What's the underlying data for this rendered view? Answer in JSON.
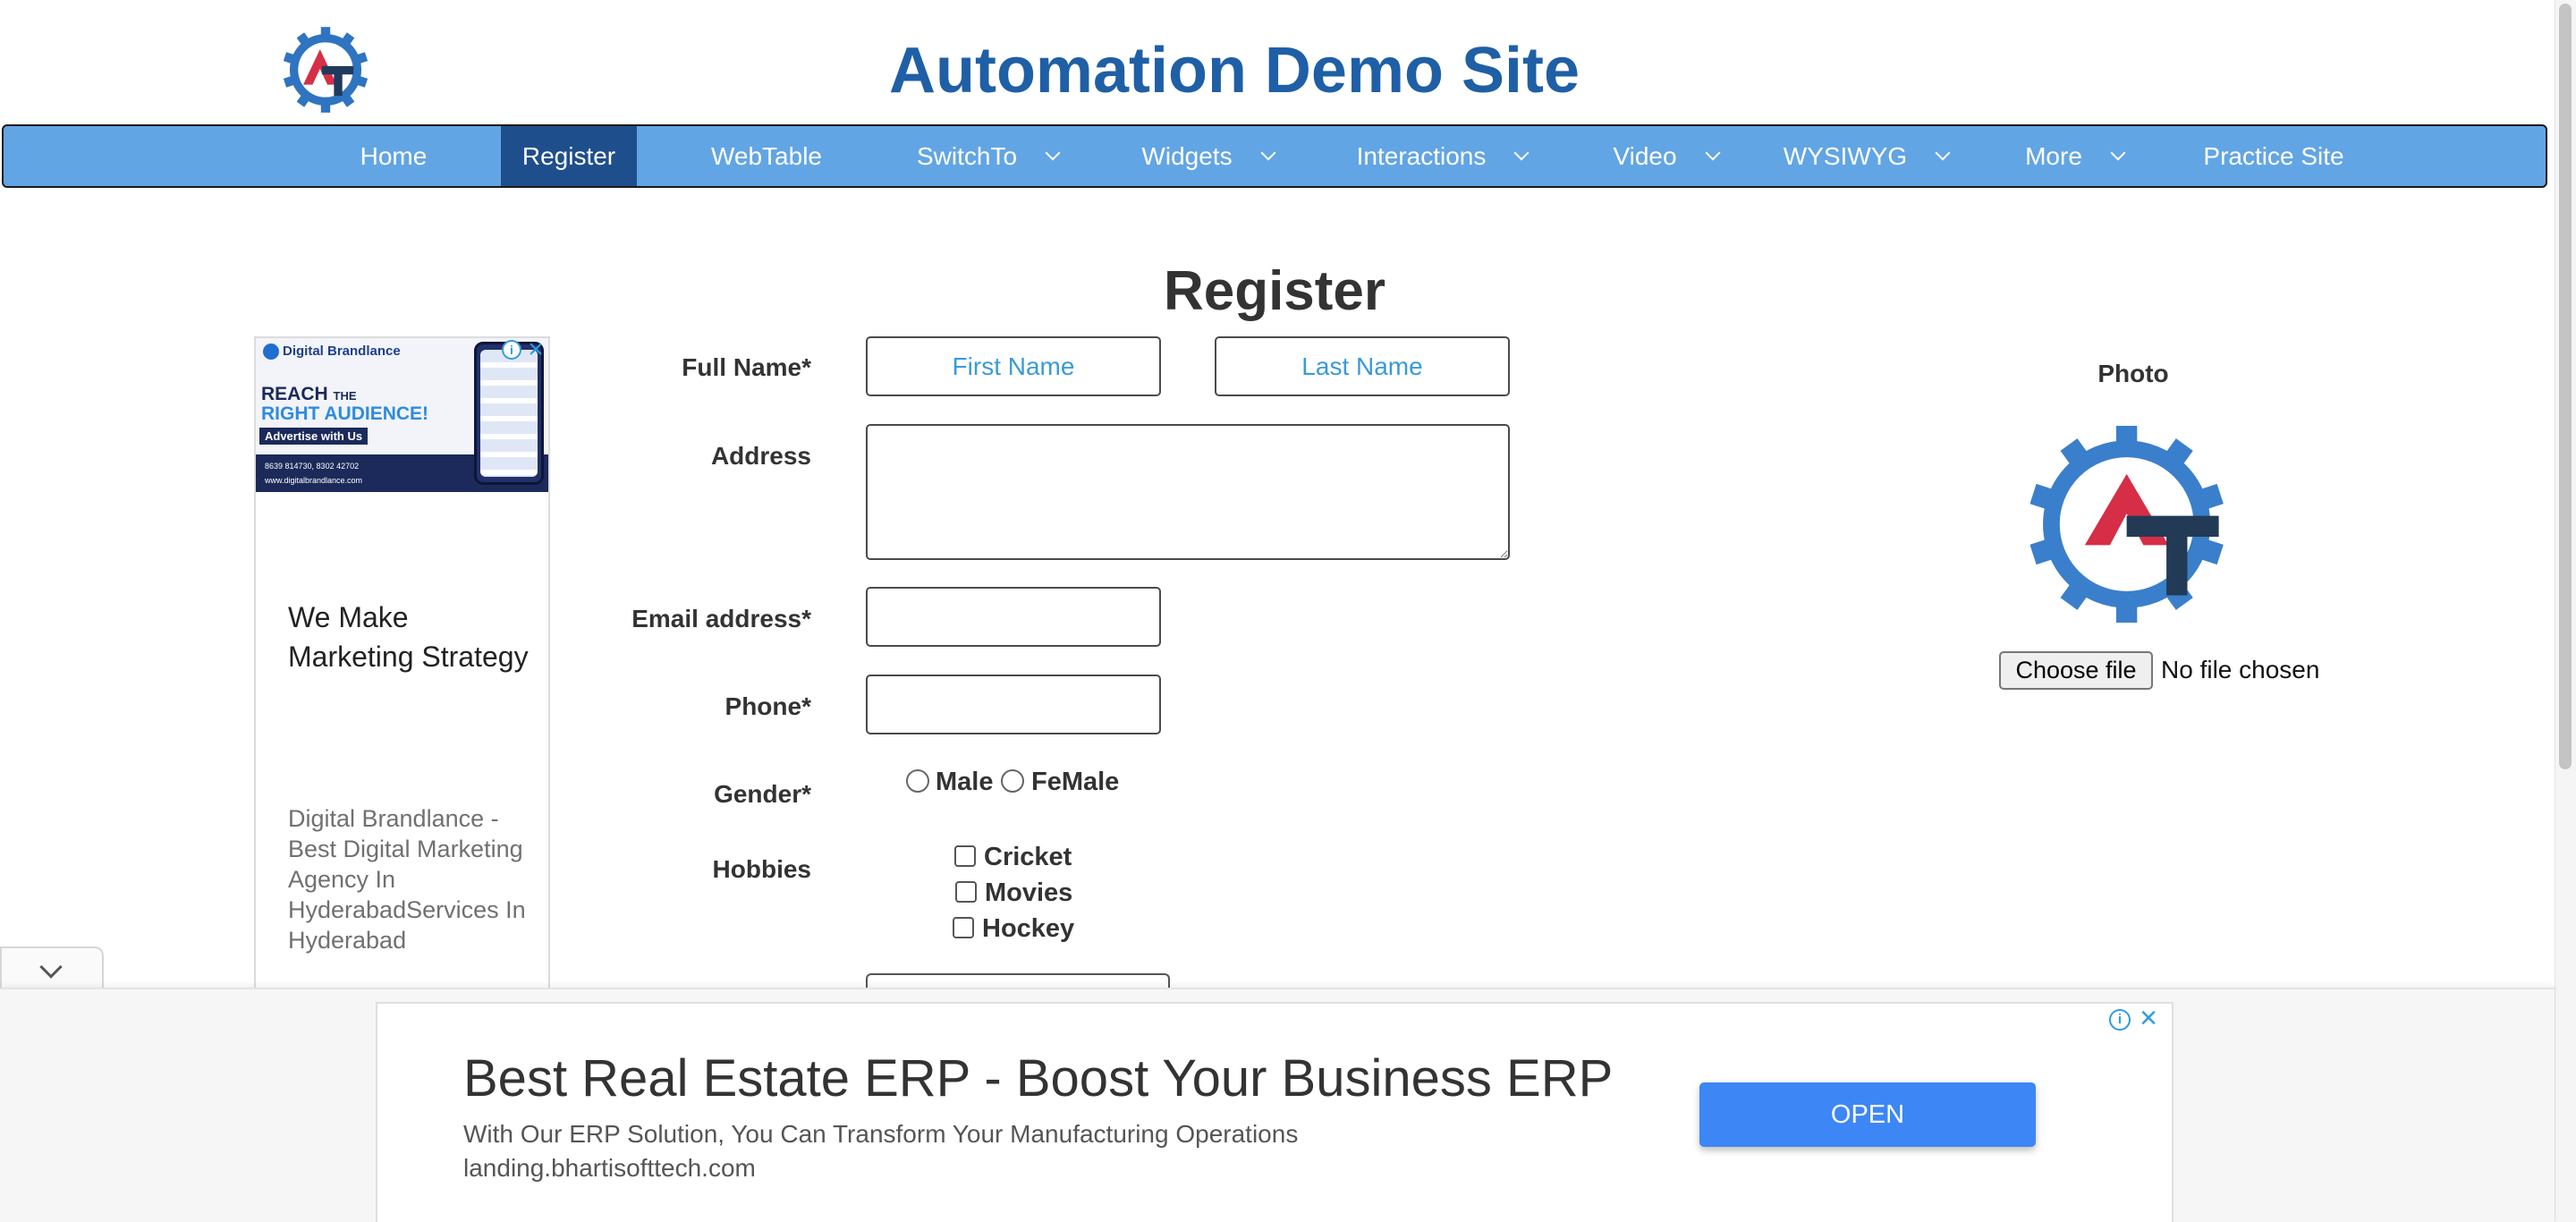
{
  "site": {
    "title": "Automation Demo Site",
    "logo_icon": "gear-at-logo-icon"
  },
  "nav": {
    "items": [
      {
        "label": "Home",
        "has_dropdown": false,
        "active": false
      },
      {
        "label": "Register",
        "has_dropdown": false,
        "active": true
      },
      {
        "label": "WebTable",
        "has_dropdown": false,
        "active": false
      },
      {
        "label": "SwitchTo",
        "has_dropdown": true,
        "active": false
      },
      {
        "label": "Widgets",
        "has_dropdown": true,
        "active": false
      },
      {
        "label": "Interactions",
        "has_dropdown": true,
        "active": false
      },
      {
        "label": "Video",
        "has_dropdown": true,
        "active": false
      },
      {
        "label": "WYSIWYG",
        "has_dropdown": true,
        "active": false
      },
      {
        "label": "More",
        "has_dropdown": true,
        "active": false
      },
      {
        "label": "Practice Site",
        "has_dropdown": false,
        "active": false
      }
    ],
    "colors": {
      "bar": "#62a5e4",
      "active": "#1f4e8c"
    }
  },
  "form": {
    "heading": "Register",
    "full_name_label": "Full Name*",
    "first_name_placeholder": "First Name",
    "last_name_placeholder": "Last Name",
    "address_label": "Address",
    "address_value": "",
    "email_label": "Email address*",
    "email_value": "",
    "phone_label": "Phone*",
    "phone_value": "",
    "gender_label": "Gender*",
    "gender_options": [
      "Male",
      "FeMale"
    ],
    "hobbies_label": "Hobbies",
    "hobbies": [
      "Cricket",
      "Movies",
      "Hockey"
    ]
  },
  "photo": {
    "label": "Photo",
    "choose_button": "Choose file",
    "file_status": "No file chosen"
  },
  "side_ad": {
    "banner_brand": "Digital Brandlance",
    "banner_reach": "REACH",
    "banner_the": "THE",
    "banner_audience": "RIGHT AUDIENCE!",
    "banner_cta": "Advertise with Us",
    "banner_contact": "8639 814730, 8302 42702",
    "banner_web": "www.digitalbrandlance.com",
    "headline": "We Make Marketing Strategy",
    "description": "Digital Brandlance - Best Digital Marketing Agency In HyderabadServices In Hyderabad"
  },
  "bottom_ad": {
    "title": "Best Real Estate ERP - Boost Your Business ERP",
    "description": "With Our ERP Solution, You Can Transform Your Manufacturing Operations",
    "url": "landing.bhartisofttech.com",
    "button": "OPEN",
    "button_color": "#3d86f5"
  }
}
